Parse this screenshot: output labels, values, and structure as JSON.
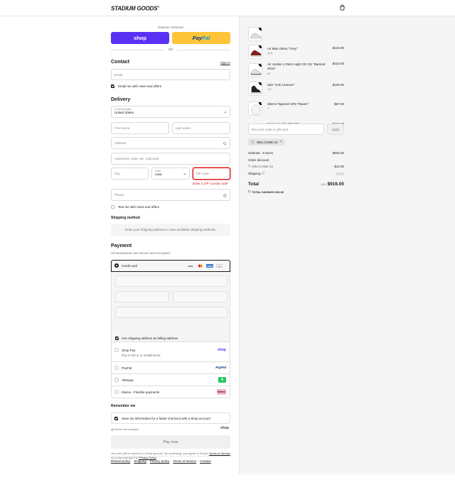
{
  "header": {
    "logo": "STADIUM GOODS",
    "logo_mark": "®"
  },
  "express": {
    "label": "Express checkout",
    "shop_label": "shop",
    "paypal_label_a": "Pay",
    "paypal_label_b": "Pal",
    "or": "OR"
  },
  "contact": {
    "title": "Contact",
    "sign_in": "Sign in",
    "email_placeholder": "Email",
    "news_label": "Email me with news and offers"
  },
  "delivery": {
    "title": "Delivery",
    "country_label": "Country/Region",
    "country_value": "United States",
    "first_name": "First name",
    "last_name": "Last name",
    "address": "Address",
    "apartment": "Apartment, suite, etc. (optional)",
    "city": "City",
    "state_label": "State",
    "state_value": "Iowa",
    "zip": "ZIP code",
    "zip_error": "Enter a ZIP / postal code",
    "phone": "Phone",
    "text_label": "Text me with news and offers"
  },
  "shipping": {
    "title": "Shipping method",
    "placeholder": "Enter your shipping address to view available shipping methods."
  },
  "payment": {
    "title": "Payment",
    "subtitle": "All transactions are secure and encrypted.",
    "credit_card": "Credit card",
    "card_badges": [
      "VISA",
      "MC",
      "AMEX",
      "+4"
    ],
    "billing_label": "Use shipping address as billing address",
    "methods": [
      {
        "name": "Shop Pay",
        "sub": "Pay in full or in installments",
        "badge": "shop"
      },
      {
        "name": "PayPal",
        "sub": "",
        "badge": "PayPal"
      },
      {
        "name": "Afterpay",
        "sub": "",
        "badge": "$"
      },
      {
        "name": "Klarna - Flexible payments",
        "sub": "",
        "badge": "Klarna."
      }
    ]
  },
  "remember": {
    "title": "Remember me",
    "save_label": "Save my information for a faster checkout with a Shop account",
    "secure": "Secure and encrypted",
    "shop": "shop"
  },
  "pay_now": "Pay now",
  "legal": {
    "text_a": "Your info will be saved to a Shop account. By continuing, you agree to Shop’s",
    "terms": "Terms of Service",
    "text_b": "and acknowledge the",
    "privacy": "Privacy Policy",
    "end": "."
  },
  "footer_links": [
    "Refund policy",
    "Shipping",
    "Privacy policy",
    "Terms of service",
    "Contact"
  ],
  "cart": {
    "items": [
      {
        "qty": "1",
        "name": "Air Max Oketo \"Grey\"",
        "variant": "11.5",
        "price": "$133.00"
      },
      {
        "qty": "1",
        "name": "Air Jordan 1 Retro High OG GS \"Banned 2016\"",
        "variant": "6Y",
        "price": "$323.00"
      },
      {
        "qty": "1",
        "name": "Star \"Hoh Lesnore\"",
        "variant": "7.5",
        "price": "$109.00"
      },
      {
        "qty": "1",
        "name": "Sk8-Hi Tapered VR3 \"Raven\"",
        "variant": "7",
        "price": "$67.00"
      },
      {
        "qty": "1",
        "name": "Gema Hoodie \"SS 20\"",
        "variant": "L",
        "price": "$264.00"
      }
    ],
    "discount_placeholder": "Discount code or gift card",
    "apply": "Apply",
    "applied_code": "WELCOME-10",
    "subtotal_label": "Subtotal · 5 items",
    "subtotal_value": "$926.00",
    "order_discount": "Order discount",
    "discount_code": "WELCOME-10",
    "discount_value": "- $10.00",
    "shipping_label": "Shipping",
    "total_label": "Total",
    "currency": "USD",
    "total_value": "$916.00",
    "savings_label": "TOTAL SAVINGS",
    "savings_value": "$10.00"
  }
}
